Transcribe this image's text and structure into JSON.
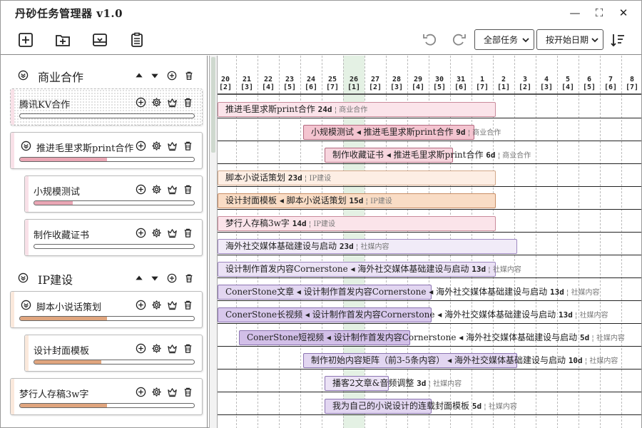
{
  "app": {
    "title": "丹砂任务管理器 v1.0"
  },
  "window_controls": {
    "minimize": "—",
    "maximize": "⛶",
    "close": "✕"
  },
  "toolbar": {
    "filter_select": "全部任务",
    "sort_select": "按开始日期"
  },
  "colors": {
    "accent_pink": "#f4c7d3",
    "pink_fill": "#e9a6b4",
    "orange_fill": "#f0c9a8",
    "orange_fill_dark": "#e0a57e",
    "purple_fill": "#d8c8ec",
    "today_col": "#e4f1e4"
  },
  "groups": [
    {
      "title": "商业合作",
      "cards": [
        {
          "title": "腾讯KV合作",
          "progress": 0.0,
          "hatched": true
        },
        {
          "title": "推进毛里求斯print合作",
          "progress": 0.5,
          "expandable": true
        },
        {
          "title": "小规模测试",
          "progress": 0.24,
          "child": true
        },
        {
          "title": "制作收藏证书",
          "progress": 0.0,
          "child": true
        }
      ]
    },
    {
      "title": "IP建设",
      "cards": [
        {
          "title": "脚本小说话策划",
          "progress": 0.5,
          "expandable": true
        },
        {
          "title": "设计封面模板",
          "progress": 0.42,
          "child": true
        },
        {
          "title": "梦行人存稿3w字",
          "progress": 0.5
        }
      ]
    }
  ],
  "gantt": {
    "dates": [
      {
        "day": "20",
        "wd": "[2]"
      },
      {
        "day": "21",
        "wd": "[3]"
      },
      {
        "day": "22",
        "wd": "[4]"
      },
      {
        "day": "23",
        "wd": "[5]"
      },
      {
        "day": "24",
        "wd": "[6]"
      },
      {
        "day": "25",
        "wd": "[7]"
      },
      {
        "day": "26",
        "wd": "[1]"
      },
      {
        "day": "27",
        "wd": "[2]"
      },
      {
        "day": "28",
        "wd": "[3]"
      },
      {
        "day": "29",
        "wd": "[4]"
      },
      {
        "day": "30",
        "wd": "[5]"
      },
      {
        "day": "31",
        "wd": "[6]"
      },
      {
        "day": "1",
        "wd": "[7]"
      },
      {
        "day": "2",
        "wd": "[1]"
      },
      {
        "day": "3",
        "wd": "[2]"
      },
      {
        "day": "4",
        "wd": "[3]"
      },
      {
        "day": "5",
        "wd": "[4]"
      },
      {
        "day": "6",
        "wd": "[5]"
      },
      {
        "day": "7",
        "wd": "[6]"
      },
      {
        "day": "8",
        "wd": "[7]"
      }
    ],
    "today_index": 6,
    "bars": [
      {
        "label": "推进毛里求斯print合作",
        "dur": "24d",
        "tag": "商业合作",
        "start": 0,
        "span": 13,
        "color": "#fbe4ea",
        "border": "#c98b9b"
      },
      {
        "label": "小规模测试 ◂ 推进毛里求斯print合作",
        "dur": "9d",
        "tag": "商业合作",
        "start": 4,
        "span": 8,
        "color": "#f4c4d0",
        "border": "#b36a80"
      },
      {
        "label": "制作收藏证书 ◂ 推进毛里求斯print合作",
        "dur": "6d",
        "tag": "商业合作",
        "start": 5,
        "span": 6,
        "color": "#f7d5de",
        "border": "#b36a80"
      },
      {
        "label": "脚本小说话策划",
        "dur": "23d",
        "tag": "IP建设",
        "start": 0,
        "span": 13,
        "color": "#fdeee4",
        "border": "#d3a889"
      },
      {
        "label": "设计封面模板 ◂ 脚本小说话策划",
        "dur": "15d",
        "tag": "IP建设",
        "start": 0,
        "span": 13,
        "color": "#f9dcc5",
        "border": "#c98d64"
      },
      {
        "label": "梦行人存稿3w字",
        "dur": "14d",
        "tag": "IP建设",
        "start": 0,
        "span": 13,
        "color": "#fbe4ea",
        "border": "#c98b9b"
      },
      {
        "label": "海外社交媒体基础建设与启动",
        "dur": "23d",
        "tag": "社媒内容",
        "start": 0,
        "span": 14,
        "color": "#f1ebf8",
        "border": "#9e88c0"
      },
      {
        "label": "设计制作首发内容Cornerstone ◂ 海外社交媒体基础建设与启动",
        "dur": "13d",
        "tag": "社媒内容",
        "start": 0,
        "span": 13,
        "color": "#ebe2f5",
        "border": "#9e88c0"
      },
      {
        "label": "ConerStone文章 ◂ 设计制作首发内容Cornerstone ◂ 海外社交媒体基础建设与启动",
        "dur": "13d",
        "tag": "社媒内容",
        "start": 0,
        "span": 10,
        "color": "#e2d6f1",
        "border": "#8c74b2"
      },
      {
        "label": "ConerStone长视频 ◂ 设计制作首发内容Cornerstone ◂ 海外社交媒体基础建设与启动",
        "dur": "13d",
        "tag": "社媒内容",
        "start": 0,
        "span": 10,
        "color": "#d8c8ec",
        "border": "#8c74b2"
      },
      {
        "label": "ConerStone短视频 ◂ 设计制作首发内容Cornerstone ◂ 海外社交媒体基础建设与启动",
        "dur": "5d",
        "tag": "社媒内容",
        "start": 1,
        "span": 8,
        "color": "#d2bfe8",
        "border": "#8c74b2"
      },
      {
        "label": "制作初始内容矩阵（前3-5条内容） ◂ 海外社交媒体基础建设与启动",
        "dur": "10d",
        "tag": "社媒内容",
        "start": 4,
        "span": 10,
        "color": "#e2d6f1",
        "border": "#8c74b2"
      },
      {
        "label": "播客2文章&音频调整",
        "dur": "3d",
        "tag": "社媒内容",
        "start": 5,
        "span": 3,
        "color": "#ebe2f5",
        "border": "#8c74b2"
      },
      {
        "label": "我为自己的小说设计的连载封面模板",
        "dur": "5d",
        "tag": "社媒内容",
        "start": 5,
        "span": 5,
        "color": "#e2d6f1",
        "border": "#8c74b2"
      }
    ]
  }
}
